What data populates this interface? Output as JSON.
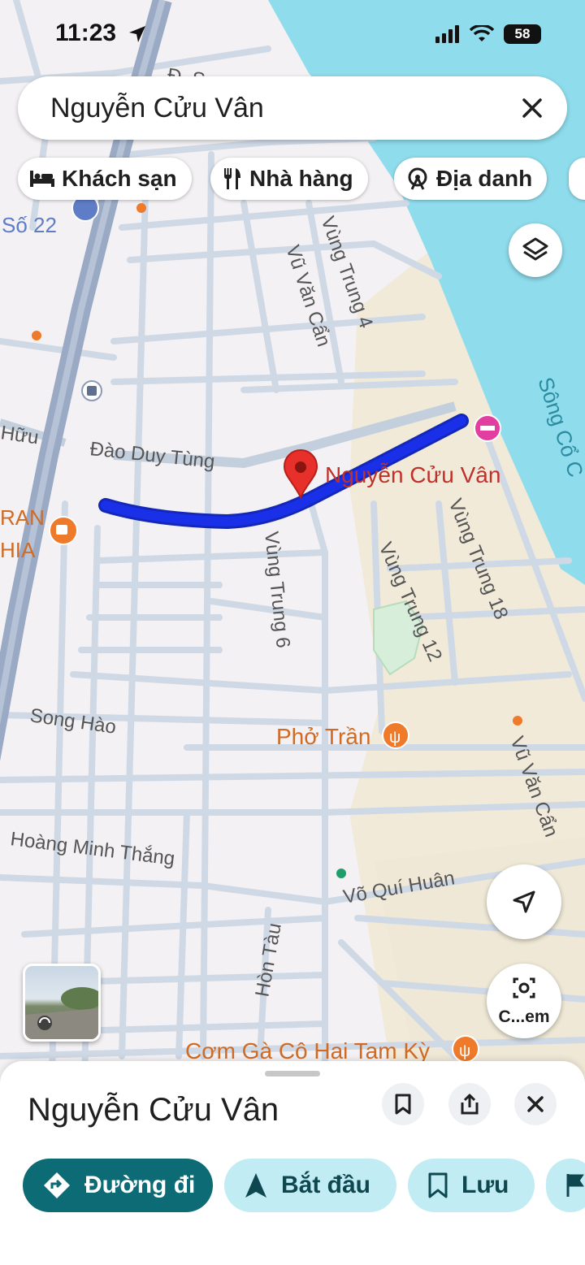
{
  "status_bar": {
    "time": "11:23",
    "battery": "58"
  },
  "search": {
    "query": "Nguyễn Cửu Vân"
  },
  "chips": [
    {
      "label": "Khách sạn",
      "icon": "bed-icon"
    },
    {
      "label": "Nhà hàng",
      "icon": "fork-knife-icon"
    },
    {
      "label": "Địa danh",
      "icon": "landmark-icon"
    }
  ],
  "map": {
    "streets": {
      "dao_duy_tung": "Đào Duy Tùng",
      "vung_trung_4": "Vùng Trung 4",
      "vu_van_can_top": "Vũ Văn Cẩn",
      "vu_van_can_bottom": "Vũ Văn Cẩn",
      "vung_trung_6": "Vùng Trung 6",
      "vung_trung_12": "Vùng Trung 12",
      "vung_trung_18": "Vùng Trung 18",
      "song_hao": "Song Hào",
      "hoang_minh_thang": "Hoàng Minh Thắng",
      "vo_qui_huan": "Võ Quí Huân",
      "hon_tau": "Hòn Tàu",
      "huu": "Hữu",
      "so_22": "Số 22",
      "river": "Sông Cổ C",
      "top_s": "Đ. S"
    },
    "places": {
      "selected": "Nguyễn Cửu Vân",
      "pho_tran": "Phở Trần",
      "com_ga": "Cơm Gà Cô Hai Tam Kỳ",
      "cafe_ran": "RAN",
      "cafe_hia": "HIA"
    },
    "colors": {
      "land": "#f3f1f3",
      "road": "#c8d4e2",
      "highway": "#9aaac4",
      "water": "#8fdcec",
      "sand": "#f1ead9",
      "route": "#1a2fe8",
      "pin": "#e8302a",
      "poi_orange": "#ee7a2a",
      "poi_pink": "#e23ea0"
    }
  },
  "buttons": {
    "layers": "layers-icon",
    "location": "navigation-arrow-icon",
    "camera_label": "C...em"
  },
  "sheet": {
    "title": "Nguyễn Cửu Vân",
    "actions": [
      {
        "label": "Đường đi",
        "icon": "directions-icon"
      },
      {
        "label": "Bắt đầu",
        "icon": "navigate-icon"
      },
      {
        "label": "Lưu",
        "icon": "bookmark-icon"
      }
    ]
  }
}
